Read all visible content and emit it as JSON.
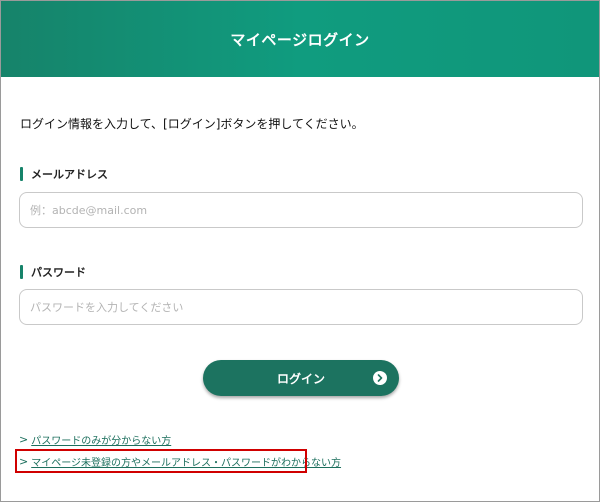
{
  "header": {
    "title": "マイページログイン"
  },
  "instruction": "ログイン情報を入力して、[ログイン]ボタンを押してください。",
  "email": {
    "label": "メールアドレス",
    "value": "",
    "placeholder": "例：abcde@mail.com"
  },
  "password": {
    "label": "パスワード",
    "value": "",
    "placeholder": "パスワードを入力してください"
  },
  "login_button": {
    "label": "ログイン",
    "icon": "chevron-right-circle-icon"
  },
  "links": [
    {
      "label": "パスワードのみが分からない方"
    },
    {
      "label": "マイページ未登録の方やメールアドレス・パスワードがわからない方"
    }
  ],
  "colors": {
    "header_gradient_start": "#16836a",
    "header_gradient_end": "#10967a",
    "button": "#1c7360",
    "link": "#1c6f5d",
    "highlight": "#d00000"
  }
}
